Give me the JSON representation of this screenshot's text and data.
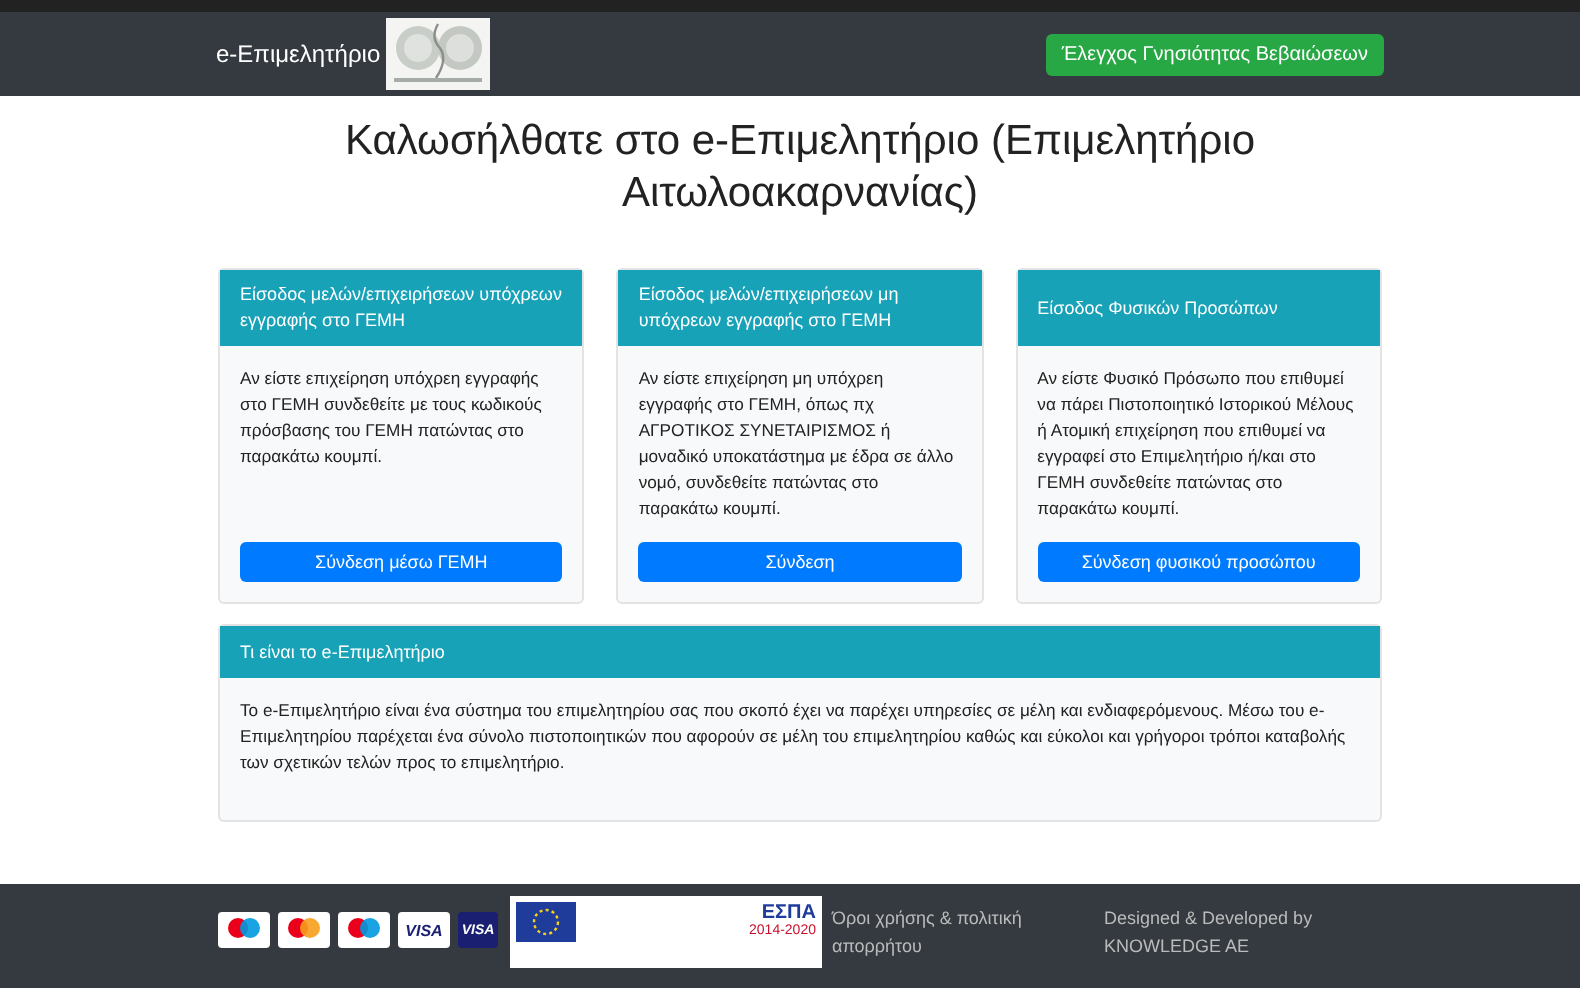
{
  "navbar": {
    "brand": "e-Επιμελητήριο",
    "verify_button": "Έλεγχος Γνησιότητας Βεβαιώσεων"
  },
  "title": "Καλωσήλθατε στο e-Επιμελητήριο (Επιμελητήριο Αιτωλοακαρνανίας)",
  "login_cards": [
    {
      "header": "Είσοδος μελών/επιχειρήσεων υπόχρεων εγγραφής στο ΓΕΜΗ",
      "text": "Αν είστε επιχείρηση υπόχρεη εγγραφής στο ΓΕΜΗ συνδεθείτε με τους κωδικούς πρόσβασης του ΓΕΜΗ πατώντας στο παρακάτω κουμπί.",
      "button": "Σύνδεση μέσω ΓΕΜΗ"
    },
    {
      "header": "Είσοδος μελών/επιχειρήσεων μη υπόχρεων εγγραφής στο ΓΕΜΗ",
      "text": "Αν είστε επιχείρηση μη υπόχρεη εγγραφής στο ΓΕΜΗ, όπως πχ ΑΓΡΟΤΙΚΟΣ ΣΥΝΕΤΑΙΡΙΣΜΟΣ ή μοναδικό υποκατάστημα με έδρα σε άλλο νομό, συνδεθείτε πατώντας στο παρακάτω κουμπί.",
      "button": "Σύνδεση"
    },
    {
      "header": "Είσοδος Φυσικών Προσώπων",
      "text": "Αν είστε Φυσικό Πρόσωπο που επιθυμεί να πάρει Πιστοποιητικό Ιστορικού Μέλους ή Ατομική επιχείρηση που επιθυμεί να εγγραφεί στο Επιμελητήριο ή/και στο ΓΕΜΗ συνδεθείτε πατώντας στο παρακάτω κουμπί.",
      "button": "Σύνδεση φυσικού προσώπου"
    }
  ],
  "about_card": {
    "header": "Τι είναι το e-Επιμελητήριο",
    "text": "Το e-Επιμελητήριο είναι ένα σύστημα του επιμελητηρίου σας που σκοπό έχει να παρέχει υπηρεσίες σε μέλη και ενδιαφερόμενους. Μέσω του e-Επιμελητηρίου παρέχεται ένα σύνολο πιστοποιητικών που αφορούν σε μέλη του επιμελητηρίου καθώς και εύκολοι και γρήγοροι τρόποι καταβολής των σχετικών τελών προς το επιμελητήριο."
  },
  "footer": {
    "payment_cards": [
      {
        "kind": "maestro"
      },
      {
        "kind": "mastercard"
      },
      {
        "kind": "maestro"
      },
      {
        "kind": "visa",
        "label": "VISA"
      },
      {
        "kind": "visa-dark",
        "label": "VISA"
      }
    ],
    "espa_banner": {
      "name": "ΕΣΠΑ",
      "years": "2014-2020"
    },
    "terms_link": "Όροι χρήσης & πολιτική απορρήτου",
    "credit": "Designed & Developed by KNOWLEDGE AE"
  }
}
